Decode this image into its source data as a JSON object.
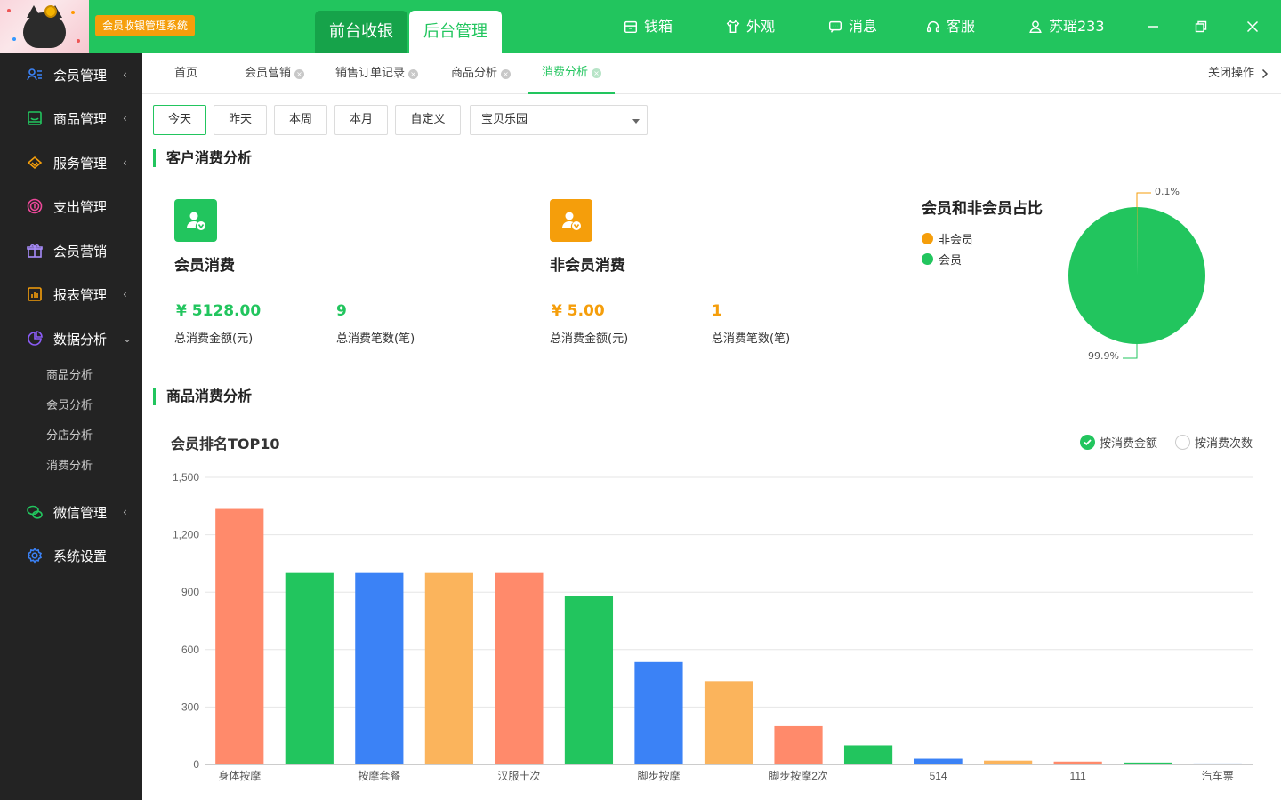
{
  "app": {
    "system_badge": "会员收银管理系统",
    "mode_tabs": [
      {
        "label": "前台收银"
      },
      {
        "label": "后台管理"
      }
    ],
    "top_items": [
      {
        "label": "钱箱",
        "icon": "cash-drawer-icon"
      },
      {
        "label": "外观",
        "icon": "tshirt-icon"
      },
      {
        "label": "消息",
        "icon": "message-icon"
      },
      {
        "label": "客服",
        "icon": "headset-icon"
      },
      {
        "label": "苏瑶233",
        "icon": "user-icon"
      }
    ],
    "accent": "#22c55e"
  },
  "sidebar": {
    "items": [
      {
        "label": "会员管理",
        "arrow": "‹"
      },
      {
        "label": "商品管理",
        "arrow": "‹"
      },
      {
        "label": "服务管理",
        "arrow": "‹"
      },
      {
        "label": "支出管理",
        "arrow": ""
      },
      {
        "label": "会员营销",
        "arrow": ""
      },
      {
        "label": "报表管理",
        "arrow": "‹"
      },
      {
        "label": "数据分析",
        "arrow": "⌄"
      },
      {
        "label": "微信管理",
        "arrow": "‹"
      },
      {
        "label": "系统设置",
        "arrow": ""
      }
    ],
    "sub_items": [
      {
        "label": "商品分析"
      },
      {
        "label": "会员分析"
      },
      {
        "label": "分店分析"
      },
      {
        "label": "消费分析"
      }
    ]
  },
  "tabs": {
    "items": [
      {
        "label": "首页"
      },
      {
        "label": "会员营销"
      },
      {
        "label": "销售订单记录"
      },
      {
        "label": "商品分析"
      },
      {
        "label": "消费分析"
      }
    ],
    "close_ops": "关闭操作"
  },
  "filters": {
    "buttons": [
      {
        "label": "今天"
      },
      {
        "label": "昨天"
      },
      {
        "label": "本周"
      },
      {
        "label": "本月"
      },
      {
        "label": "自定义"
      }
    ],
    "store": "宝贝乐园"
  },
  "customer_section": {
    "title": "客户消费分析",
    "member": {
      "title": "会员消费",
      "amount": "¥ 5128.00",
      "amount_label": "总消费金额(元)",
      "count": "9",
      "count_label": "总消费笔数(笔)",
      "color": "#22c55e"
    },
    "non_member": {
      "title": "非会员消费",
      "amount": "¥ 5.00",
      "amount_label": "总消费金额(元)",
      "count": "1",
      "count_label": "总消费笔数(笔)",
      "color": "#f59e0b"
    },
    "pie": {
      "title": "会员和非会员占比",
      "legend": [
        {
          "label": "非会员",
          "color": "#f59e0b"
        },
        {
          "label": "会员",
          "color": "#22c55e"
        }
      ],
      "label_small": "0.1%",
      "label_large": "99.9%"
    }
  },
  "product_section": {
    "title": "商品消费分析",
    "chart_title": "会员排名TOP10",
    "radio_amount": "按消费金额",
    "radio_count": "按消费次数"
  },
  "chart_data": [
    {
      "type": "pie",
      "title": "会员和非会员占比",
      "labels": [
        "非会员",
        "会员"
      ],
      "values": [
        0.1,
        99.9
      ],
      "colors": [
        "#f59e0b",
        "#22c55e"
      ]
    },
    {
      "type": "bar",
      "title": "会员排名TOP10",
      "ylim": [
        0,
        1500
      ],
      "yticks": [
        "0",
        "300",
        "600",
        "900",
        "1,200",
        "1,500"
      ],
      "grid": true,
      "categories": [
        "身体按摩",
        "",
        "按摩套餐",
        "",
        "汉服十次",
        "",
        "脚步按摩",
        "",
        "脚步按摩2次",
        "",
        "514",
        "",
        "111",
        "",
        "汽车票"
      ],
      "values": [
        1335,
        1000,
        1000,
        1000,
        1000,
        880,
        535,
        435,
        200,
        100,
        30,
        20,
        15,
        10,
        5
      ],
      "colors": [
        "#ff8a6b",
        "#22c55e",
        "#3b82f6",
        "#fbb45c",
        "#ff8a6b",
        "#22c55e",
        "#3b82f6",
        "#fbb45c",
        "#ff8a6b",
        "#22c55e",
        "#3b82f6",
        "#fbb45c",
        "#ff8a6b",
        "#22c55e",
        "#3b82f6"
      ]
    }
  ]
}
